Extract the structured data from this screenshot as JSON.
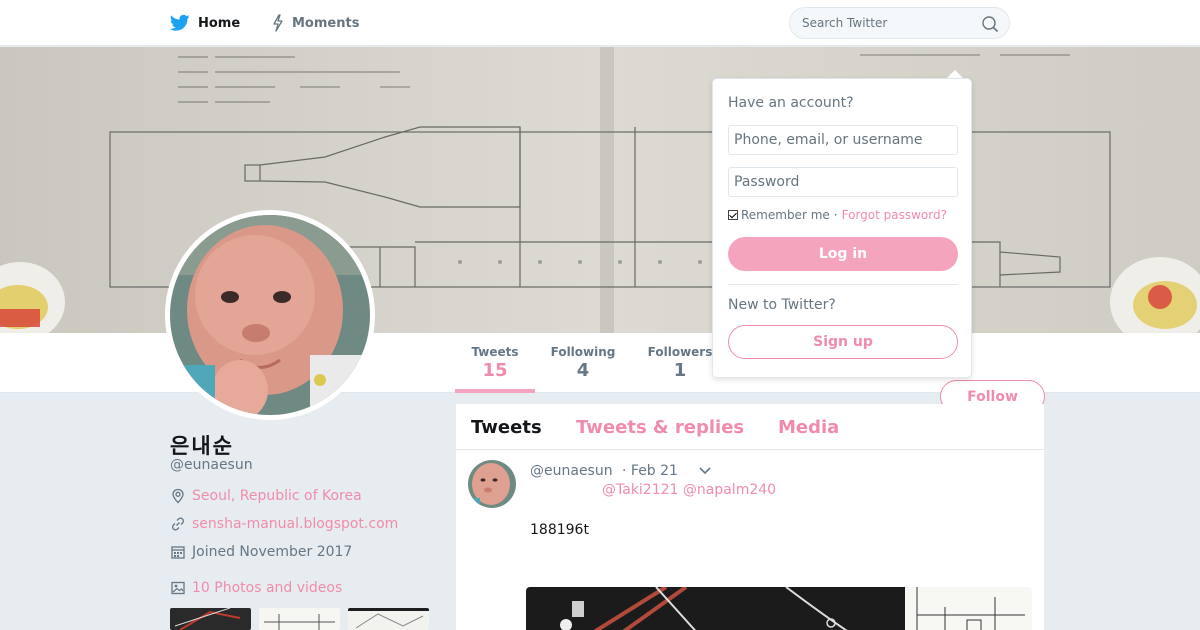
{
  "nav": {
    "home_label": "Home",
    "moments_label": "Moments",
    "search_placeholder": "Search Twitter"
  },
  "profile": {
    "name": "은내순",
    "handle": "@eunaesun",
    "location": "Seoul, Republic of Korea",
    "url": "sensha-manual.blogspot.com",
    "joined": "Joined November 2017",
    "photos_label": "10 Photos and videos"
  },
  "stats": {
    "tweets_label": "Tweets",
    "tweets_value": "15",
    "following_label": "Following",
    "following_value": "4",
    "followers_label": "Followers",
    "followers_value": "1"
  },
  "follow_label": "Follow",
  "tabs": {
    "tweets": "Tweets",
    "replies": "Tweets & replies",
    "media": "Media"
  },
  "tweet": {
    "handle": "@eunaesun",
    "time": "· Feb 21",
    "mentions": "@Taki2121 @napalm240",
    "text": "188196t"
  },
  "login": {
    "heading": "Have an account?",
    "username_placeholder": "Phone, email, or username",
    "password_placeholder": "Password",
    "remember_label": "Remember me",
    "separator": "·",
    "forgot_label": "Forgot password?",
    "login_label": "Log in",
    "new_heading": "New to Twitter?",
    "signup_label": "Sign up"
  },
  "colors": {
    "accent": "#f08cab",
    "accent_light": "#f4a4bd",
    "twitter_blue": "#1da1f2",
    "background": "#e6ecf0"
  },
  "icons": {
    "brand": "twitter-bird-icon",
    "moments": "lightning-icon",
    "search": "magnifier-icon",
    "location": "map-pin-icon",
    "url": "link-icon",
    "joined": "calendar-icon",
    "photos": "image-icon",
    "caret": "chevron-down-icon"
  }
}
